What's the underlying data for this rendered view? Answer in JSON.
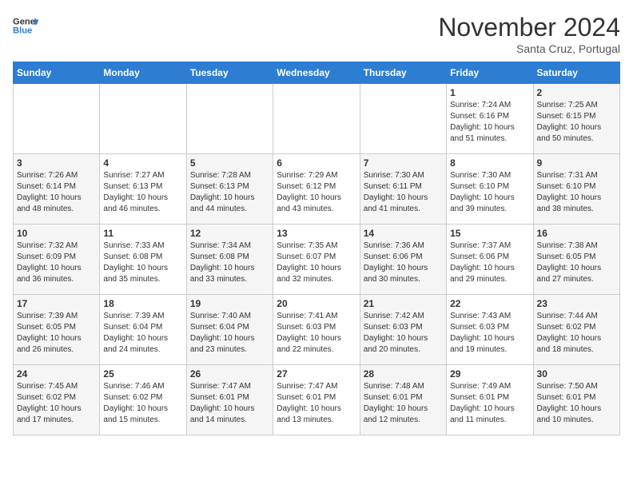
{
  "header": {
    "logo_line1": "General",
    "logo_line2": "Blue",
    "month": "November 2024",
    "location": "Santa Cruz, Portugal"
  },
  "days_of_week": [
    "Sunday",
    "Monday",
    "Tuesday",
    "Wednesday",
    "Thursday",
    "Friday",
    "Saturday"
  ],
  "weeks": [
    [
      {
        "day": "",
        "info": ""
      },
      {
        "day": "",
        "info": ""
      },
      {
        "day": "",
        "info": ""
      },
      {
        "day": "",
        "info": ""
      },
      {
        "day": "",
        "info": ""
      },
      {
        "day": "1",
        "info": "Sunrise: 7:24 AM\nSunset: 6:16 PM\nDaylight: 10 hours and 51 minutes."
      },
      {
        "day": "2",
        "info": "Sunrise: 7:25 AM\nSunset: 6:15 PM\nDaylight: 10 hours and 50 minutes."
      }
    ],
    [
      {
        "day": "3",
        "info": "Sunrise: 7:26 AM\nSunset: 6:14 PM\nDaylight: 10 hours and 48 minutes."
      },
      {
        "day": "4",
        "info": "Sunrise: 7:27 AM\nSunset: 6:13 PM\nDaylight: 10 hours and 46 minutes."
      },
      {
        "day": "5",
        "info": "Sunrise: 7:28 AM\nSunset: 6:13 PM\nDaylight: 10 hours and 44 minutes."
      },
      {
        "day": "6",
        "info": "Sunrise: 7:29 AM\nSunset: 6:12 PM\nDaylight: 10 hours and 43 minutes."
      },
      {
        "day": "7",
        "info": "Sunrise: 7:30 AM\nSunset: 6:11 PM\nDaylight: 10 hours and 41 minutes."
      },
      {
        "day": "8",
        "info": "Sunrise: 7:30 AM\nSunset: 6:10 PM\nDaylight: 10 hours and 39 minutes."
      },
      {
        "day": "9",
        "info": "Sunrise: 7:31 AM\nSunset: 6:10 PM\nDaylight: 10 hours and 38 minutes."
      }
    ],
    [
      {
        "day": "10",
        "info": "Sunrise: 7:32 AM\nSunset: 6:09 PM\nDaylight: 10 hours and 36 minutes."
      },
      {
        "day": "11",
        "info": "Sunrise: 7:33 AM\nSunset: 6:08 PM\nDaylight: 10 hours and 35 minutes."
      },
      {
        "day": "12",
        "info": "Sunrise: 7:34 AM\nSunset: 6:08 PM\nDaylight: 10 hours and 33 minutes."
      },
      {
        "day": "13",
        "info": "Sunrise: 7:35 AM\nSunset: 6:07 PM\nDaylight: 10 hours and 32 minutes."
      },
      {
        "day": "14",
        "info": "Sunrise: 7:36 AM\nSunset: 6:06 PM\nDaylight: 10 hours and 30 minutes."
      },
      {
        "day": "15",
        "info": "Sunrise: 7:37 AM\nSunset: 6:06 PM\nDaylight: 10 hours and 29 minutes."
      },
      {
        "day": "16",
        "info": "Sunrise: 7:38 AM\nSunset: 6:05 PM\nDaylight: 10 hours and 27 minutes."
      }
    ],
    [
      {
        "day": "17",
        "info": "Sunrise: 7:39 AM\nSunset: 6:05 PM\nDaylight: 10 hours and 26 minutes."
      },
      {
        "day": "18",
        "info": "Sunrise: 7:39 AM\nSunset: 6:04 PM\nDaylight: 10 hours and 24 minutes."
      },
      {
        "day": "19",
        "info": "Sunrise: 7:40 AM\nSunset: 6:04 PM\nDaylight: 10 hours and 23 minutes."
      },
      {
        "day": "20",
        "info": "Sunrise: 7:41 AM\nSunset: 6:03 PM\nDaylight: 10 hours and 22 minutes."
      },
      {
        "day": "21",
        "info": "Sunrise: 7:42 AM\nSunset: 6:03 PM\nDaylight: 10 hours and 20 minutes."
      },
      {
        "day": "22",
        "info": "Sunrise: 7:43 AM\nSunset: 6:03 PM\nDaylight: 10 hours and 19 minutes."
      },
      {
        "day": "23",
        "info": "Sunrise: 7:44 AM\nSunset: 6:02 PM\nDaylight: 10 hours and 18 minutes."
      }
    ],
    [
      {
        "day": "24",
        "info": "Sunrise: 7:45 AM\nSunset: 6:02 PM\nDaylight: 10 hours and 17 minutes."
      },
      {
        "day": "25",
        "info": "Sunrise: 7:46 AM\nSunset: 6:02 PM\nDaylight: 10 hours and 15 minutes."
      },
      {
        "day": "26",
        "info": "Sunrise: 7:47 AM\nSunset: 6:01 PM\nDaylight: 10 hours and 14 minutes."
      },
      {
        "day": "27",
        "info": "Sunrise: 7:47 AM\nSunset: 6:01 PM\nDaylight: 10 hours and 13 minutes."
      },
      {
        "day": "28",
        "info": "Sunrise: 7:48 AM\nSunset: 6:01 PM\nDaylight: 10 hours and 12 minutes."
      },
      {
        "day": "29",
        "info": "Sunrise: 7:49 AM\nSunset: 6:01 PM\nDaylight: 10 hours and 11 minutes."
      },
      {
        "day": "30",
        "info": "Sunrise: 7:50 AM\nSunset: 6:01 PM\nDaylight: 10 hours and 10 minutes."
      }
    ]
  ]
}
